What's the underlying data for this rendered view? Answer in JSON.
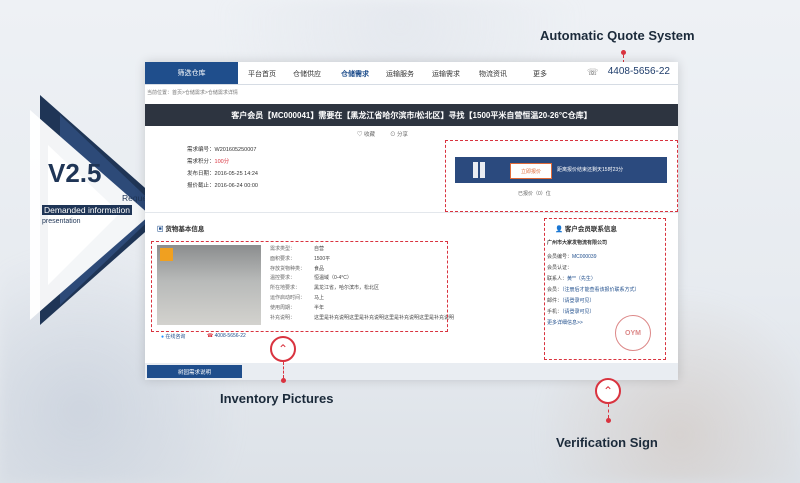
{
  "annotations": {
    "quote": "Automatic Quote System",
    "inventory": "Inventory Pictures",
    "verification": "Verification Sign"
  },
  "banner": {
    "version": "V2.5",
    "line1": "Requested&",
    "line2": "Demanded information",
    "line3": "presentation"
  },
  "nav": {
    "items": [
      "筛选仓库",
      "平台首页",
      "仓储供应",
      "仓储需求",
      "运输服务",
      "运输需求",
      "物流资讯",
      "更多"
    ],
    "phone": "4408-5656-22"
  },
  "breadcrumb": "当前位置：首页>仓储需求>仓储需求详情",
  "title": "客户会员【MC000041】需要在【黑龙江省哈尔滨市/松北区】寻找【1500平米自营恒温20-26°C仓库】",
  "actions": [
    "收藏",
    "分享"
  ],
  "info": {
    "id_label": "需求编号：",
    "id": "W201605250007",
    "score_label": "需求积分：",
    "score": "100分",
    "pub_label": "发布日期：",
    "pub": "2016-05-25 14:24",
    "end_label": "报价截止：",
    "end": "2016-06-24 00:00"
  },
  "quote": {
    "button": "立即报价",
    "text": "距离报价结束还剩天15时23分",
    "count": "已报价（0）位"
  },
  "goods": {
    "title": "货物基本信息",
    "attrs": [
      [
        "需求类型：",
        "自营"
      ],
      [
        "面积要求：",
        "1500平"
      ],
      [
        "存放货物种类：",
        "食品"
      ],
      [
        "温控要求：",
        "恒温域（0-4°C）"
      ],
      [
        "所在地要求：",
        "黑龙江省，哈尔滨市，松北区"
      ],
      [
        "运作启动时间：",
        "马上"
      ],
      [
        "使用周期：",
        "半年"
      ],
      [
        "补充说明：",
        "这里是补充说明这里是补充说明这里是补充说明这里是补充说明"
      ]
    ],
    "online": "在线咨询",
    "tel": "4008-5656-22"
  },
  "contact": {
    "title": "客户会员联系信息",
    "company": "广州市大家发物流有限公司",
    "rows": [
      [
        "会员编号：",
        "MC000039"
      ],
      [
        "会员认证：",
        ""
      ],
      [
        "联系人：",
        "黄**（先生）"
      ],
      [
        "会员：",
        "（注册后才能查看该报价联系方式）"
      ],
      [
        "邮件：",
        "（请登录可见）"
      ],
      [
        "手机：",
        "（请登录可见）"
      ]
    ],
    "more": "更多详细信息>>",
    "stamp": "OYM"
  },
  "desc_tab": "树园需求说明"
}
